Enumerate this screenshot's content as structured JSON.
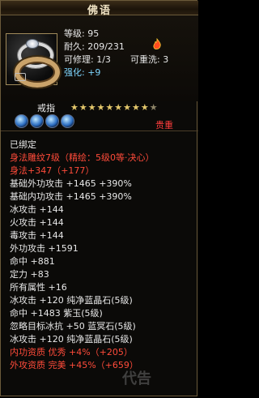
{
  "window": {
    "title": "佛语"
  },
  "item": {
    "level_label": "等级:",
    "level_value": "95",
    "durability_label": "耐久:",
    "durability_value": "209/231",
    "repair_label": "可修理:",
    "repair_value": "1/3",
    "reroll_label": "可重洗:",
    "reroll_value": "3",
    "enhance_label": "强化:",
    "enhance_value": "+9",
    "type_label": "戒指",
    "stars_filled": 9,
    "stars_total": 10,
    "gem_count": 4,
    "weight_text": "贵重"
  },
  "stats": [
    {
      "text": "已绑定",
      "color": "white"
    },
    {
      "text": "身法雕纹7级（精绘：5级0等·决心）",
      "color": "red"
    },
    {
      "text": "身法+347（+177）",
      "color": "red"
    },
    {
      "text": "基础外功攻击 +1465 +390%",
      "color": "white"
    },
    {
      "text": "基础内功攻击 +1465 +390%",
      "color": "white"
    },
    {
      "text": "冰攻击 +144",
      "color": "white"
    },
    {
      "text": "火攻击 +144",
      "color": "white"
    },
    {
      "text": "毒攻击 +144",
      "color": "white"
    },
    {
      "text": "外功攻击 +1591",
      "color": "white"
    },
    {
      "text": "命中 +881",
      "color": "white"
    },
    {
      "text": "定力 +83",
      "color": "white"
    },
    {
      "text": "所有属性 +16",
      "color": "white"
    },
    {
      "text": "冰攻击 +120 纯净蓝晶石(5级)",
      "color": "white"
    },
    {
      "text": "命中 +1483 紫玉(5级)",
      "color": "white"
    },
    {
      "text": "忽略目标冰抗 +50 蓝冥石(5级)",
      "color": "white"
    },
    {
      "text": "冰攻击 +120 纯净蓝晶石(5级)",
      "color": "white"
    },
    {
      "text": "内功资质 优秀 +4%（+205）",
      "color": "red"
    },
    {
      "text": "外攻资质 完美 +45%（+659）",
      "color": "red"
    }
  ],
  "watermark": "代告"
}
